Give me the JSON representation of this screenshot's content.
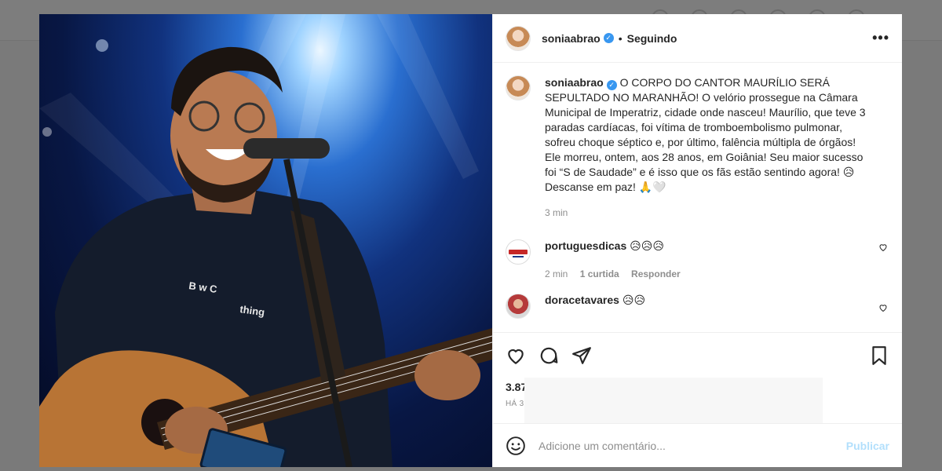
{
  "colors": {
    "accent": "#0095f6",
    "verified": "#3897f0",
    "text": "#262626",
    "muted": "#8e8e8e",
    "publish_disabled": "#b2dffc"
  },
  "header": {
    "username": "soniaabrao",
    "separator": "•",
    "follow_status": "Seguindo",
    "more_label": "•••"
  },
  "caption": {
    "username": "soniaabrao",
    "text": "O CORPO DO CANTOR MAURÍLIO SERÁ SEPULTADO NO MARANHÃO! O velório prossegue na Câmara Municipal de Imperatriz, cidade onde nasceu! Maurílio, que teve 3 paradas cardíacas, foi vítima de tromboembolismo pulmonar, sofreu choque séptico e, por último, falência múltipla de órgãos! Ele morreu, ontem, aos 28 anos, em Goiânia! Seu maior sucesso foi “S de Saudade” e é isso que os fãs estão sentindo agora! 😥Descanse em paz! 🙏🤍",
    "time": "3 min"
  },
  "comments": [
    {
      "username": "portuguesdicas",
      "text": "😥😥😥",
      "time": "2 min",
      "likes": "1 curtida",
      "reply": "Responder"
    },
    {
      "username": "doracetavares",
      "text": "😥😥"
    }
  ],
  "icons": {
    "like": "heart-icon",
    "comment": "comment-icon",
    "share": "share-icon",
    "save": "bookmark-icon",
    "emoji": "emoji-icon"
  },
  "stats": {
    "likes": "3.87",
    "posted": "HÁ 3"
  },
  "add_comment": {
    "placeholder": "Adicione um comentário...",
    "publish": "Publicar"
  }
}
